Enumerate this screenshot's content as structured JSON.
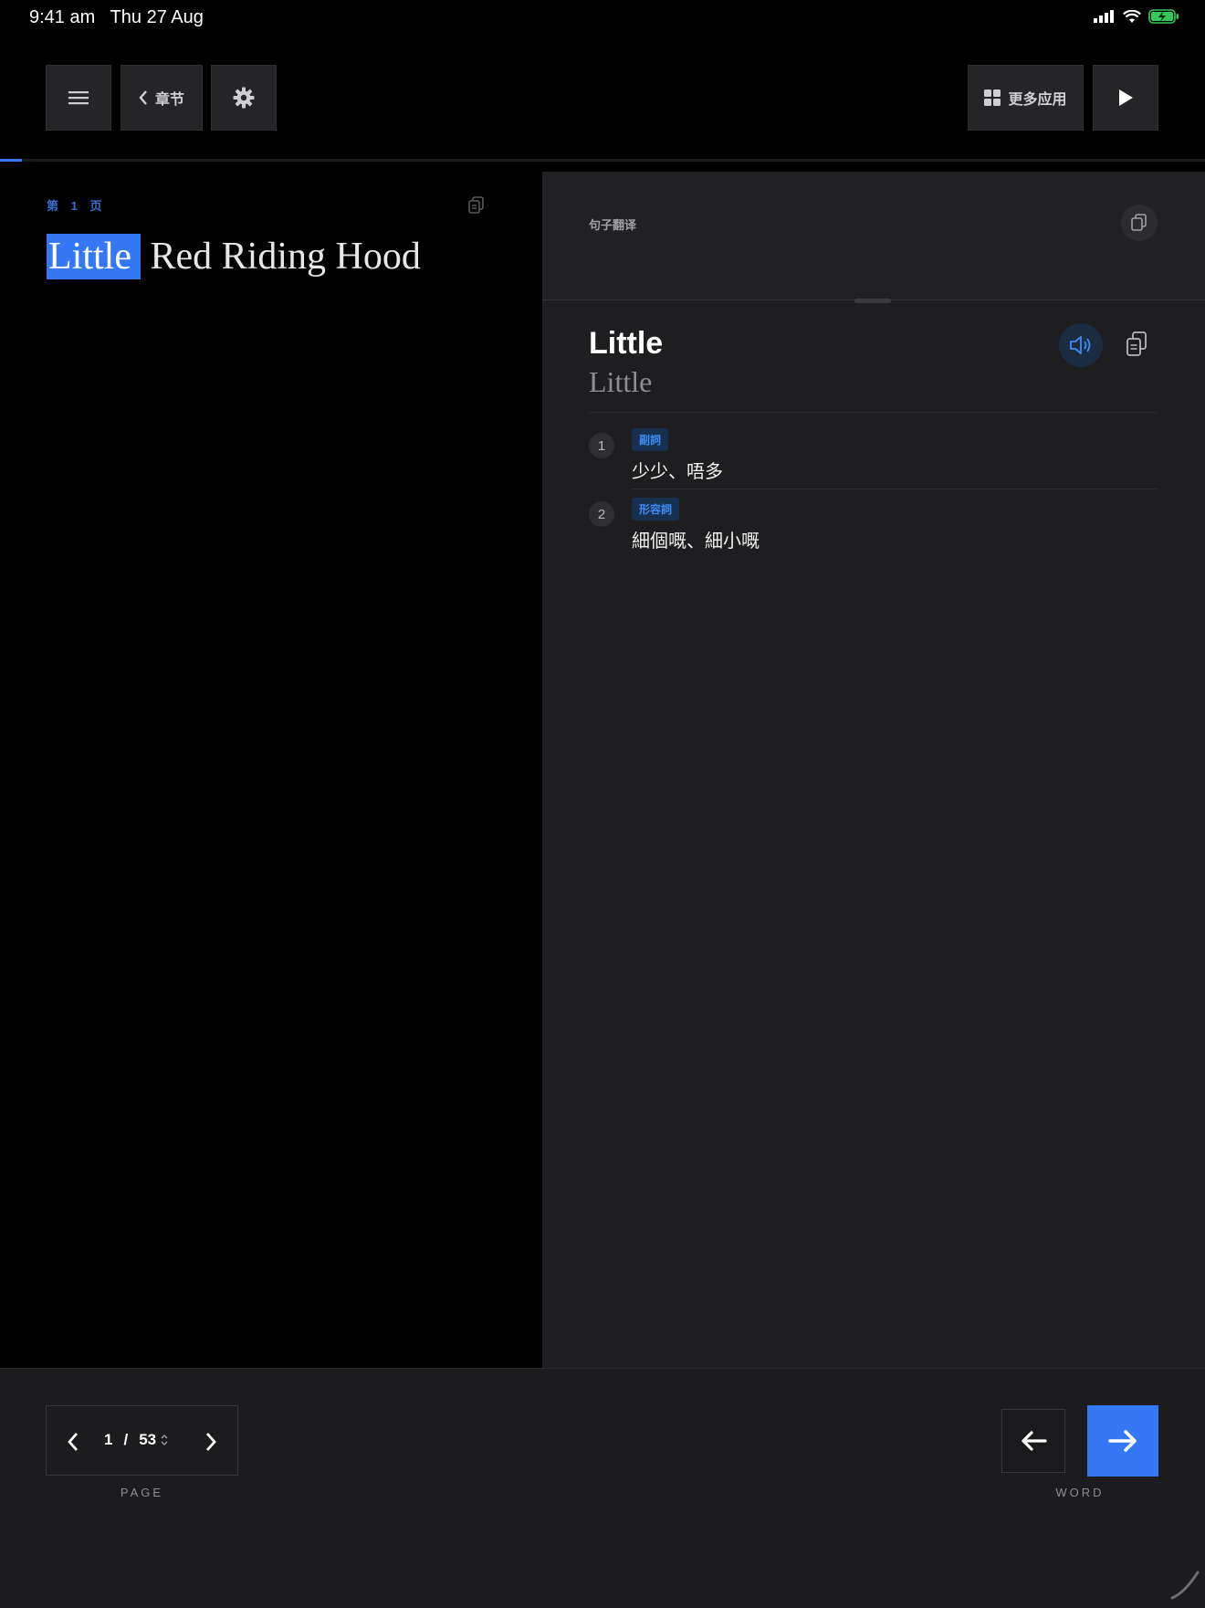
{
  "status": {
    "time": "9:41 am",
    "date": "Thu 27 Aug"
  },
  "toolbar": {
    "menu_icon": "hamburger-icon",
    "chapter_label": "章节",
    "settings_icon": "gear-icon",
    "more_apps_label": "更多应用",
    "play_icon": "play-icon"
  },
  "reading_progress": 0.018,
  "page": {
    "label": "第 1 页",
    "highlighted_word": "Little",
    "rest_of_line": "Red Riding Hood"
  },
  "translation": {
    "label": "句子翻译"
  },
  "dictionary": {
    "word": "Little",
    "form": "Little",
    "definitions": [
      {
        "index": "1",
        "pos": "副詞",
        "meaning": "少少、唔多"
      },
      {
        "index": "2",
        "pos": "形容詞",
        "meaning": "細個嘅、細小嘅"
      }
    ]
  },
  "pager": {
    "current": "1",
    "separator": "/",
    "total": "53",
    "label": "PAGE"
  },
  "word_nav": {
    "label": "WORD"
  },
  "colors": {
    "accent": "#3478f6",
    "panel": "#1e1e20",
    "background": "#000000"
  }
}
